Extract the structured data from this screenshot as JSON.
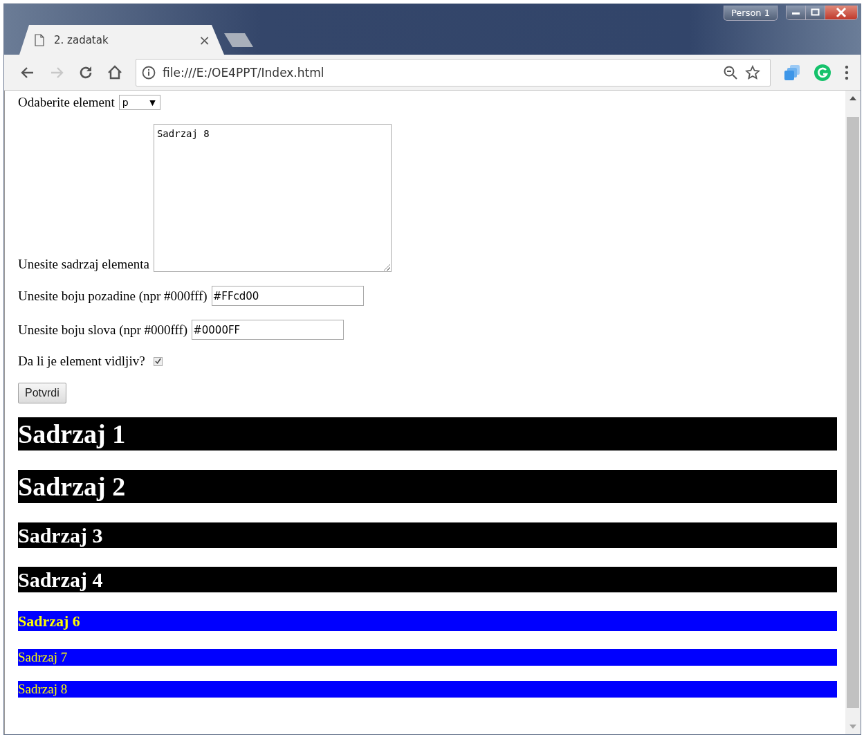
{
  "browser": {
    "tab": {
      "title": "2. zadatak",
      "close": "×"
    },
    "profile": "Person 1",
    "address": "file:///E:/OE4PPT/Index.html",
    "can_go_forward": false
  },
  "form": {
    "select": {
      "label": "Odaberite element",
      "value": "p",
      "arrow": "▼"
    },
    "content": {
      "label": "Unesite sadrzaj elementa",
      "value": "Sadrzaj 8"
    },
    "background": {
      "label": "Unesite boju pozadine (npr #000fff)",
      "value": "#FFcd00"
    },
    "text_color": {
      "label": "Unesite boju slova (npr #000fff)",
      "value": "#0000FF"
    },
    "visible": {
      "label": "Da li je element vidljiv?",
      "checked": true
    },
    "submit": "Potvrdi"
  },
  "elements": [
    {
      "kind": "h1",
      "color": "#000000",
      "text": "Sadrzaj 1"
    },
    {
      "kind": "h1",
      "color": "#000000",
      "text": "Sadrzaj 2"
    },
    {
      "kind": "h2",
      "color": "#000000",
      "text": "Sadrzaj 3"
    },
    {
      "kind": "h2",
      "color": "#000000",
      "text": "Sadrzaj 4"
    },
    {
      "kind": "h3",
      "color": "#0000ff",
      "text": "Sadrzaj 6"
    },
    {
      "kind": "p",
      "color": "#0000ff",
      "text": "Sadrzaj 7"
    },
    {
      "kind": "p",
      "color": "#0000ff",
      "text": "Sadrzaj 8"
    }
  ]
}
